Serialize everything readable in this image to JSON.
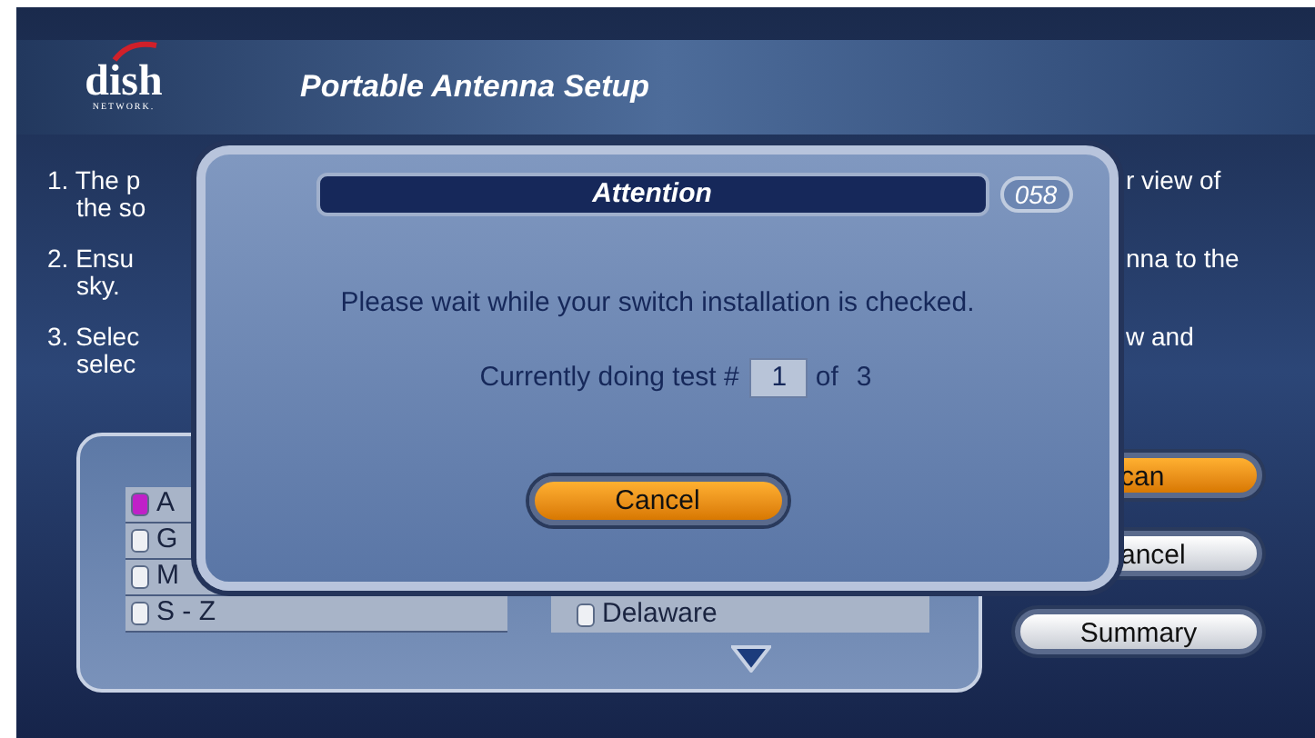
{
  "header": {
    "logo": {
      "wordmark": "dish",
      "tagline": "NETWORK."
    },
    "title": "Portable Antenna Setup"
  },
  "instructions": [
    {
      "left_lines": [
        "1. The p",
        "the so"
      ],
      "right_lines": [
        "r view of"
      ]
    },
    {
      "left_lines": [
        "2. Ensu",
        "sky."
      ],
      "right_lines": [
        "nna to the"
      ]
    },
    {
      "left_lines": [
        "3. Selec",
        "selec"
      ],
      "right_lines": [
        "w and"
      ]
    }
  ],
  "state_list": {
    "column_1": [
      {
        "label": "A",
        "checked": true
      },
      {
        "label": "G",
        "checked": false
      },
      {
        "label": "M",
        "checked": false
      },
      {
        "label": "S - Z",
        "checked": false
      }
    ],
    "column_2": [
      {
        "label": "Delaware",
        "checked": false
      }
    ]
  },
  "side_buttons": [
    {
      "label": "can",
      "highlighted": true
    },
    {
      "label": "ancel",
      "highlighted": false
    },
    {
      "label": "Summary",
      "highlighted": false
    }
  ],
  "dialog": {
    "title": "Attention",
    "code": "058",
    "message": "Please wait while your switch installation is checked.",
    "progress": {
      "prefix": "Currently doing test #",
      "current": "1",
      "of_label": "of",
      "total": "3"
    },
    "button": {
      "label": "Cancel",
      "highlighted": true
    }
  }
}
